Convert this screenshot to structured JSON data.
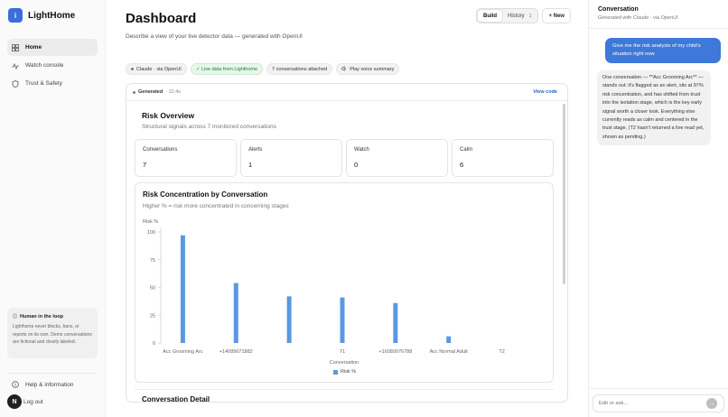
{
  "app": {
    "name": "LightHome",
    "logo_glyph": "i"
  },
  "sidebar": {
    "items": [
      {
        "label": "Home",
        "icon": "grid-icon",
        "active": true
      },
      {
        "label": "Watch console",
        "icon": "pulse-icon",
        "active": false
      },
      {
        "label": "Trust & Safety",
        "icon": "shield-icon",
        "active": false
      }
    ],
    "loop_card": {
      "title": "Human in the loop",
      "text": "Lighthome never blocks, bans, or reports on its own. Demo conversations are fictional and clearly labeled."
    },
    "help_label": "Help & information",
    "logout_label": "Log out",
    "avatar_initial": "N"
  },
  "header": {
    "title": "Dashboard",
    "subtitle": "Describe a view of your live detector data — generated with OpenUI",
    "build_label": "Build",
    "history_label": "History",
    "history_count": "1",
    "new_label": "+ New"
  },
  "chips": {
    "model": "Claude · via OpenUI",
    "live": "✓ Live data from Lighthome",
    "attached": "7 conversations attached",
    "voice": "Play voice summary"
  },
  "generated": {
    "label": "Generated",
    "time": "· 12.4s",
    "view_code": "View code"
  },
  "risk_overview": {
    "title": "Risk Overview",
    "subtitle": "Structural signals across 7 monitored conversations",
    "stats": [
      {
        "label": "Conversations",
        "value": "7"
      },
      {
        "label": "Alerts",
        "value": "1"
      },
      {
        "label": "Watch",
        "value": "0"
      },
      {
        "label": "Calm",
        "value": "6"
      }
    ]
  },
  "chart_data": {
    "type": "bar",
    "title": "Risk Concentration by Conversation",
    "subtitle": "Higher % = risk more concentrated in concerning stages",
    "ylabel": "Risk %",
    "xlabel": "Conversation",
    "ylim": [
      0,
      100
    ],
    "yticks": [
      0,
      25,
      50,
      75,
      100
    ],
    "grid": false,
    "legend": "bottom",
    "categories": [
      "Acc Grooming Arc",
      "+14089671882",
      "",
      "T1",
      "+16089976788",
      "Acc Normal Adult",
      "T2"
    ],
    "series": [
      {
        "name": "Risk %",
        "color": "#5b98e2",
        "values": [
          97,
          54,
          42,
          41,
          36,
          6,
          0
        ]
      }
    ]
  },
  "detail": {
    "title": "Conversation Detail"
  },
  "panel": {
    "title": "Conversation",
    "subtitle": "Generated with Claude · via OpenUI",
    "user_message": "Give me the risk analysis of my child's situation right now",
    "ai_message": "One conversation — **Acc Grooming Arc** — stands out: it's flagged as an alert, sits at 97% risk concentration, and has shifted from trust into the isolation stage, which is the key early signal worth a closer look. Everything else currently reads as calm and centered in the trust stage. (T2 hasn't returned a live read yet, shown as pending.)",
    "input_placeholder": "Edit or ask...",
    "send_glyph": "→"
  }
}
